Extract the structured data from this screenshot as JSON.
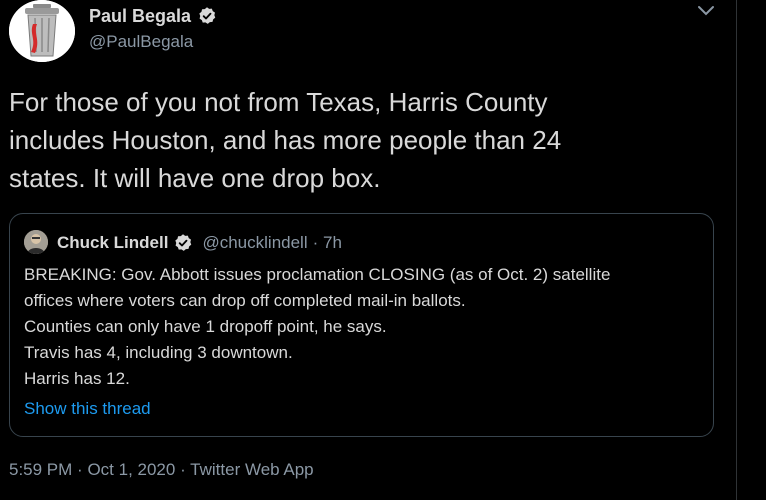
{
  "author": {
    "name": "Paul Begala",
    "handle": "@PaulBegala"
  },
  "tweet": {
    "lines": [
      "For those of you not from Texas, Harris County",
      "includes Houston, and has more people than 24",
      "states.  It will have one drop box."
    ]
  },
  "quoted": {
    "name": "Chuck Lindell",
    "handle": "@chucklindell",
    "time": "· 7h",
    "lines": [
      "BREAKING: Gov. Abbott issues proclamation CLOSING (as of Oct. 2) satellite",
      "offices where voters can drop off completed mail-in ballots.",
      "Counties can only have 1 dropoff point, he says.",
      "Travis has 4, including 3 downtown.",
      "Harris has 12."
    ],
    "show_thread": "Show this thread"
  },
  "meta": {
    "time": "5:59 PM",
    "date": "Oct 1, 2020",
    "source": "Twitter Web App",
    "sep": "·"
  },
  "icons": {
    "verified": "verified-badge-icon",
    "caret": "chevron-down-icon"
  },
  "colors": {
    "background": "#000000",
    "text": "#d9d9d9",
    "secondary": "#8b98a5",
    "link": "#1d9bf0",
    "border": "#38444d"
  }
}
